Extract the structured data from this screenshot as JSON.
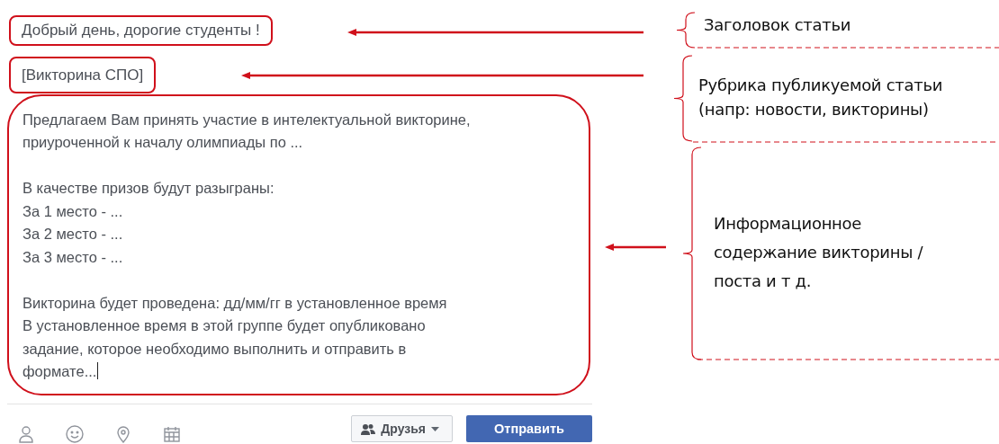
{
  "post": {
    "title": "Добрый день, дорогие студенты !",
    "category": "[Викторина СПО]",
    "body": [
      [
        "Предлагаем Вам принять участие в интелектуальной викторине,",
        "приуроченной к началу олимпиады по ..."
      ],
      [
        "В качестве призов будут разыграны:",
        "За 1 место - ...",
        "За 2 место - ...",
        "За 3 место - ..."
      ],
      [
        "Викторина будет проведена: дд/мм/гг в установленное время",
        "В установленное время в этой группе будет опубликовано",
        "задание, которое необходимо выполнить и отправить в",
        "формате..."
      ]
    ],
    "audience_button": "Друзья",
    "submit_button": "Отправить"
  },
  "annotations": [
    {
      "lines": [
        "Заголовок статьи"
      ]
    },
    {
      "lines": [
        "Рубрика публикуемой статьи",
        "(напр: новости, викторины)"
      ]
    },
    {
      "lines": [
        "Информационное",
        "содержание викторины /",
        "поста и т д."
      ]
    }
  ]
}
